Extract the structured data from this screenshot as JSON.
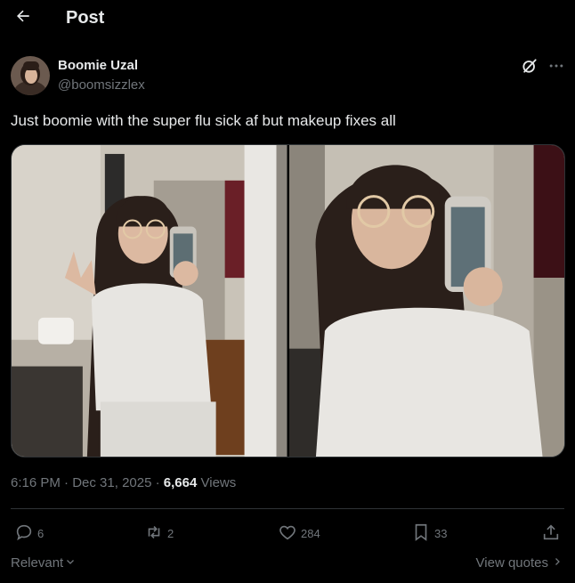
{
  "header": {
    "title": "Post"
  },
  "author": {
    "name": "Boomie Uzal",
    "handle": "@boomsizzlex"
  },
  "post": {
    "text": "Just boomie with the super flu sick af but makeup fixes all",
    "media_count": 2
  },
  "meta": {
    "time": "6:16 PM",
    "sep1": "·",
    "date": "Dec 31, 2025",
    "sep2": "·",
    "views_count": "6,664",
    "views_label": "Views"
  },
  "actions": {
    "replies": "6",
    "reposts": "2",
    "likes": "284",
    "bookmarks": "33"
  },
  "footer": {
    "sort_label": "Relevant",
    "view_quotes": "View quotes"
  },
  "icons": {
    "back": "arrow-left-icon",
    "grok": "grok-icon",
    "more": "more-icon",
    "reply": "reply-icon",
    "repost": "repost-icon",
    "like": "heart-icon",
    "bookmark": "bookmark-icon",
    "share": "share-icon"
  },
  "colors": {
    "background": "#000000",
    "text": "#e7e9ea",
    "secondary": "#71767b",
    "border": "#2f3336"
  }
}
